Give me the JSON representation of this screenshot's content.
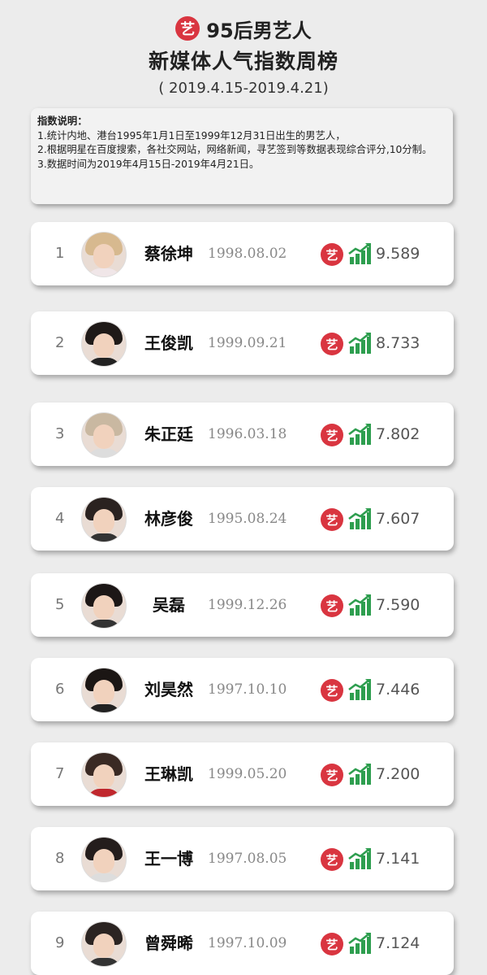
{
  "header": {
    "logo_char": "艺",
    "title_line1": "95后男艺人",
    "title_line2": "新媒体人气指数周榜",
    "date_range": "( 2019.4.15-2019.4.21)"
  },
  "notes": {
    "heading": "指数说明：",
    "line1": "1.统计内地、港台1995年1月1日至1999年12月31日出生的男艺人，",
    "line2": "2.根据明星在百度搜索，各社交网站，网络新闻，寻艺签到等数据表现综合评分,10分制。",
    "line3": "3.数据时间为2019年4月15日-2019年4月21日。"
  },
  "icons": {
    "brand_char": "艺",
    "trend_icon": "bar-trend-up-icon",
    "brand_color": "#d93540",
    "trend_color": "#2e9e4f"
  },
  "ranking": [
    {
      "rank": "1",
      "name": "蔡徐坤",
      "birth": "1998.08.02",
      "score": "9.589"
    },
    {
      "rank": "2",
      "name": "王俊凯",
      "birth": "1999.09.21",
      "score": "8.733"
    },
    {
      "rank": "3",
      "name": "朱正廷",
      "birth": "1996.03.18",
      "score": "7.802"
    },
    {
      "rank": "4",
      "name": "林彦俊",
      "birth": "1995.08.24",
      "score": "7.607"
    },
    {
      "rank": "5",
      "name": "吴磊",
      "birth": "1999.12.26",
      "score": "7.590"
    },
    {
      "rank": "6",
      "name": "刘昊然",
      "birth": "1997.10.10",
      "score": "7.446"
    },
    {
      "rank": "7",
      "name": "王琳凯",
      "birth": "1999.05.20",
      "score": "7.200"
    },
    {
      "rank": "8",
      "name": "王一博",
      "birth": "1997.08.05",
      "score": "7.141"
    },
    {
      "rank": "9",
      "name": "曾舜晞",
      "birth": "1997.10.09",
      "score": "7.124"
    }
  ]
}
